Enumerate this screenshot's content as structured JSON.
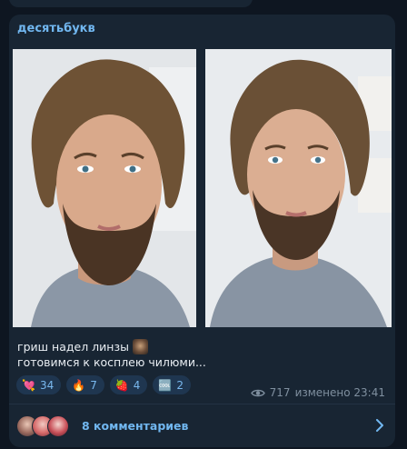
{
  "post": {
    "author": "десятьбукв",
    "caption_line1": "гриш надел линзы",
    "caption_line2": "готовимся к косплею чилюми...",
    "views": "717",
    "edited_time": "изменено 23:41"
  },
  "reactions": [
    {
      "emoji": "💘",
      "count": "34"
    },
    {
      "emoji": "🔥",
      "count": "7"
    },
    {
      "emoji": "🍓",
      "count": "4"
    },
    {
      "emoji": "🆒",
      "count": "2"
    }
  ],
  "comments": {
    "label": "8 комментариев"
  },
  "colors": {
    "background": "#0e1621",
    "bubble": "#182533",
    "accent": "#71b7f0",
    "reaction_bg": "#1f3650"
  }
}
